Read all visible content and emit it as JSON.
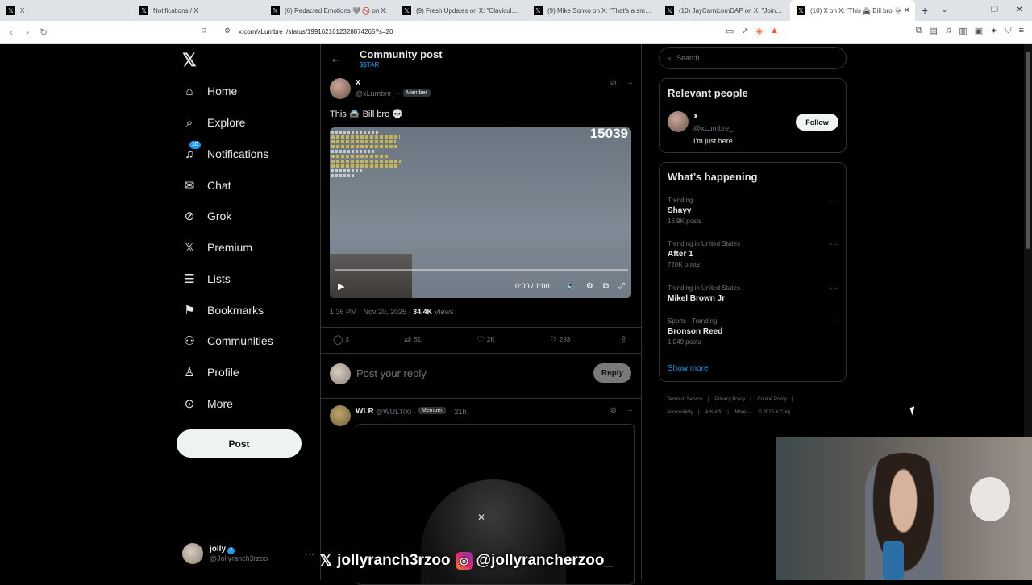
{
  "browser": {
    "tabs": [
      {
        "title": "X"
      },
      {
        "title": "Notifications / X"
      },
      {
        "title": "(6) Redacted Emotions 🩶 🚫 on X:"
      },
      {
        "title": "(9) Fresh Updates on X: \"Clavicular a"
      },
      {
        "title": "(9) Mike Sonko on X: \"That's a smart"
      },
      {
        "title": "(10) JayCarnicomDAP on X: \"Join htt"
      },
      {
        "title": "(10) X on X: \"This 🚔 Bill bro 💀"
      }
    ],
    "url": "x.com/xLumbre_/status/1991621612328874265?s=20"
  },
  "nav": {
    "items": [
      {
        "label": "Home",
        "icon": "home-icon"
      },
      {
        "label": "Explore",
        "icon": "search-icon"
      },
      {
        "label": "Notifications",
        "icon": "bell-icon",
        "badge": "10"
      },
      {
        "label": "Chat",
        "icon": "mail-icon"
      },
      {
        "label": "Grok",
        "icon": "grok-icon"
      },
      {
        "label": "Premium",
        "icon": "x-logo-icon"
      },
      {
        "label": "Lists",
        "icon": "list-icon"
      },
      {
        "label": "Bookmarks",
        "icon": "bookmark-icon"
      },
      {
        "label": "Communities",
        "icon": "people-icon"
      },
      {
        "label": "Profile",
        "icon": "person-icon"
      },
      {
        "label": "More",
        "icon": "more-circle-icon"
      }
    ],
    "post_label": "Post",
    "account": {
      "name": "jolly",
      "handle": "@Jollyranch3rzoo"
    }
  },
  "header": {
    "title": "Community post",
    "subtitle": "$$TAR"
  },
  "post": {
    "author": "x",
    "handle": "@xLumbre_ ·",
    "member_badge": "Member",
    "text": "This 🚔 Bill bro 💀",
    "video": {
      "overlay_count": "15039",
      "time": "0:00 / 1:00"
    },
    "timestamp": "1:36 PM · Nov 20, 2025 ·",
    "views": "34.4K",
    "views_label": "Views",
    "stats": {
      "replies": "3",
      "reposts": "51",
      "likes": "2K",
      "bookmarks": "293"
    }
  },
  "reply_box": {
    "placeholder": "Post your reply",
    "button": "Reply"
  },
  "reply": {
    "name": "WLR",
    "handle": "@WULT00 ·",
    "member_badge": "Member",
    "time": "· 21h"
  },
  "right": {
    "search_placeholder": "Search",
    "relevant": {
      "title": "Relevant people",
      "name": "x",
      "handle": "@xLumbre_",
      "bio": "I'm just here .",
      "follow_label": "Follow"
    },
    "happening": {
      "title": "What’s happening",
      "trends": [
        {
          "category": "Trending",
          "name": "Shayy",
          "count": "16.9K posts"
        },
        {
          "category": "Trending in United States",
          "name": "After 1",
          "count": "720K posts"
        },
        {
          "category": "Trending in United States",
          "name": "Mikel Brown Jr",
          "count": ""
        },
        {
          "category": "Sports · Trending",
          "name": "Bronson Reed",
          "count": "1,049 posts"
        }
      ],
      "show_more": "Show more"
    },
    "footer": [
      "Terms of Service",
      "|",
      "Privacy Policy",
      "|",
      "Cookie Policy",
      "|",
      "Accessibility",
      "|",
      "Ads info",
      "|",
      "More ···",
      "© 2025 X Corp."
    ]
  },
  "stream_overlay": {
    "x_handle": "jollyranch3rzoo",
    "ig_handle": "@jollyrancherzoo_"
  },
  "colors": {
    "accent": "#1d9bf0",
    "background": "#000000",
    "border": "#2f3336"
  }
}
